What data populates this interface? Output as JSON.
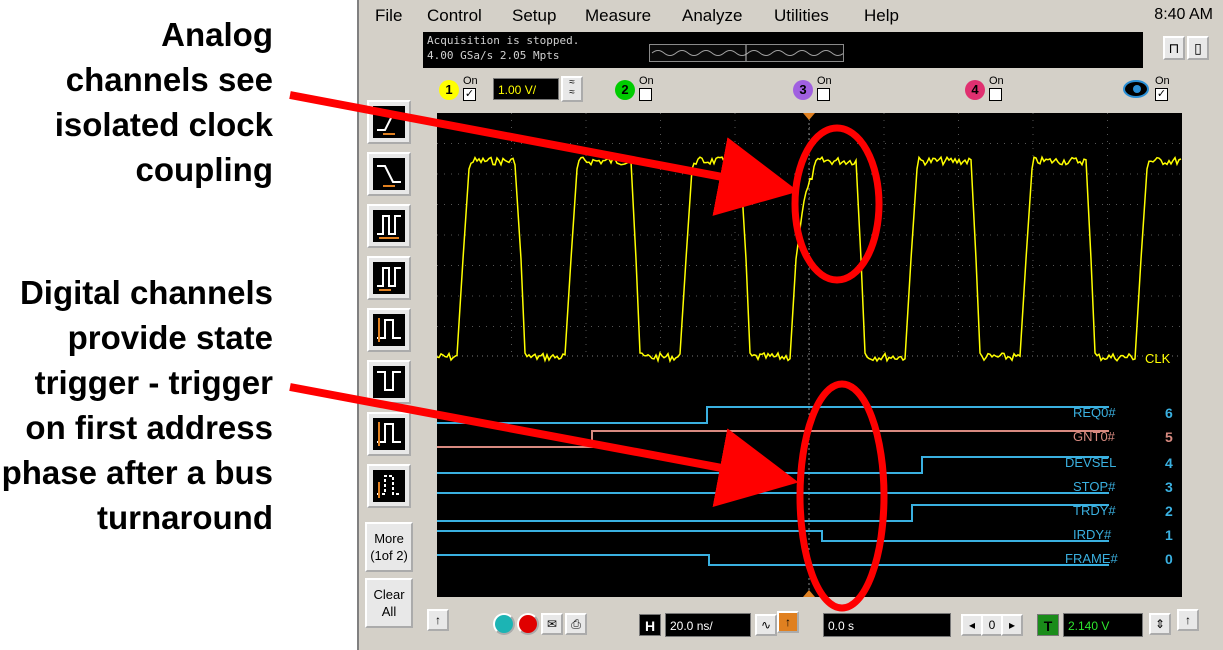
{
  "annotations": {
    "analog_note": [
      "Analog",
      "channels see",
      "isolated clock",
      "coupling"
    ],
    "digital_note": [
      "Digital channels",
      "provide state",
      "trigger - trigger",
      "on first address",
      "phase after a bus",
      "turnaround"
    ]
  },
  "menu": {
    "items": [
      "File",
      "Control",
      "Setup",
      "Measure",
      "Analyze",
      "Utilities",
      "Help"
    ],
    "clock": "8:40 AM"
  },
  "status": {
    "line1": "Acquisition is stopped.",
    "line2": "4.00 GSa/s   2.05 Mpts"
  },
  "channels": [
    {
      "num": "1",
      "on_label": "On",
      "checked": true,
      "color": "#ffff00",
      "scale": "1.00 V/"
    },
    {
      "num": "2",
      "on_label": "On",
      "checked": false,
      "color": "#00cc00"
    },
    {
      "num": "3",
      "on_label": "On",
      "checked": false,
      "color": "#a060e0"
    },
    {
      "num": "4",
      "on_label": "On",
      "checked": false,
      "color": "#e03070"
    },
    {
      "num": "eye",
      "on_label": "On",
      "checked": true,
      "color": "#2a8fd6"
    }
  ],
  "toolbar": {
    "more_label": "More\n(1of 2)",
    "more_l1": "More",
    "more_l2": "(1of 2)",
    "clear_l1": "Clear",
    "clear_l2": "All"
  },
  "analog_label": "CLK",
  "digital_channels": [
    {
      "name": "REQ0#",
      "num": "6",
      "color": "#3ab0e0"
    },
    {
      "name": "GNT0#",
      "num": "5",
      "color": "#d88a80"
    },
    {
      "name": "DEVSEL",
      "num": "4",
      "color": "#3ab0e0"
    },
    {
      "name": "STOP#",
      "num": "3",
      "color": "#3ab0e0"
    },
    {
      "name": "TRDY#",
      "num": "2",
      "color": "#3ab0e0"
    },
    {
      "name": "IRDY#",
      "num": "1",
      "color": "#3ab0e0"
    },
    {
      "name": "FRAME#",
      "num": "0",
      "color": "#3ab0e0"
    }
  ],
  "bottom": {
    "h_label": "H",
    "timebase": "20.0 ns/",
    "delay": "0.0 s",
    "t_label": "T",
    "trigger_level": "2.140 V"
  },
  "colors": {
    "ch1": "#ffff00",
    "digital": "#3ab0e0",
    "digital_alt": "#d88a80",
    "annotation": "#ff0000"
  }
}
